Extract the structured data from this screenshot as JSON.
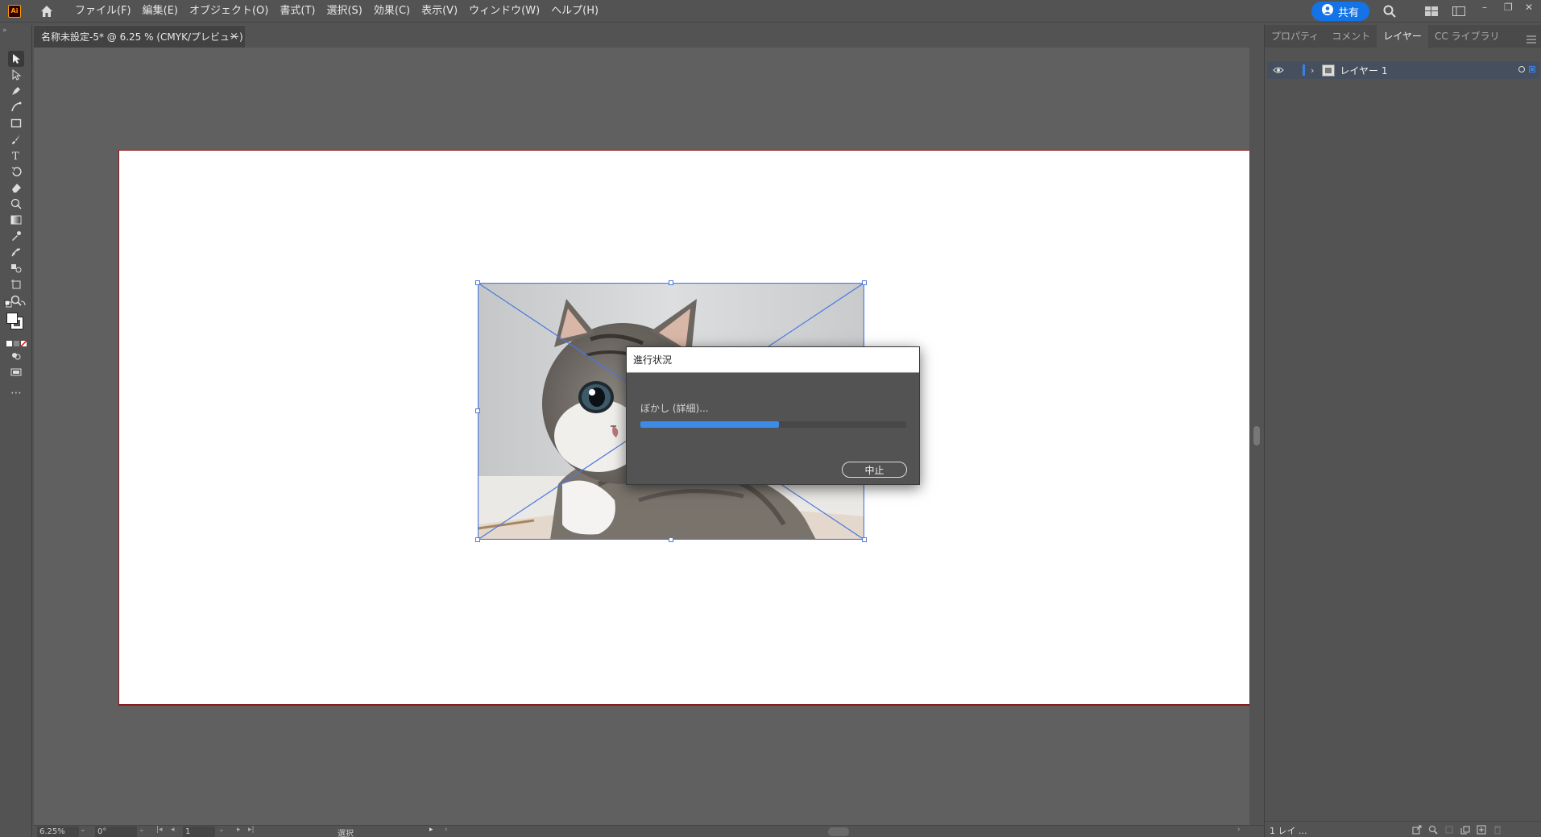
{
  "app": {
    "logo_text": "Ai",
    "menu": [
      "ファイル(F)",
      "編集(E)",
      "オブジェクト(O)",
      "書式(T)",
      "選択(S)",
      "効果(C)",
      "表示(V)",
      "ウィンドウ(W)",
      "ヘルプ(H)"
    ],
    "share_label": "共有",
    "accent_color": "#1473e6"
  },
  "document_tab": {
    "title": "名称未設定-5* @ 6.25 % (CMYK/プレビュー)",
    "close_glyph": "×"
  },
  "progress_dialog": {
    "title": "進行状況",
    "status_text": "ぼかし (詳細)...",
    "progress": 0.52,
    "cancel_label": "中止",
    "bar_color": "#3d8be8"
  },
  "status_bar": {
    "zoom": "6.25%",
    "rotation": "0°",
    "artboard_number": "1",
    "current_tool": "選択"
  },
  "right_panel": {
    "tabs": [
      "プロパティ",
      "コメント",
      "レイヤー",
      "CC ライブラリ"
    ],
    "active_tab": "レイヤー",
    "layers": [
      {
        "name": "レイヤー 1"
      }
    ],
    "footer_label": "1 レイ ..."
  }
}
